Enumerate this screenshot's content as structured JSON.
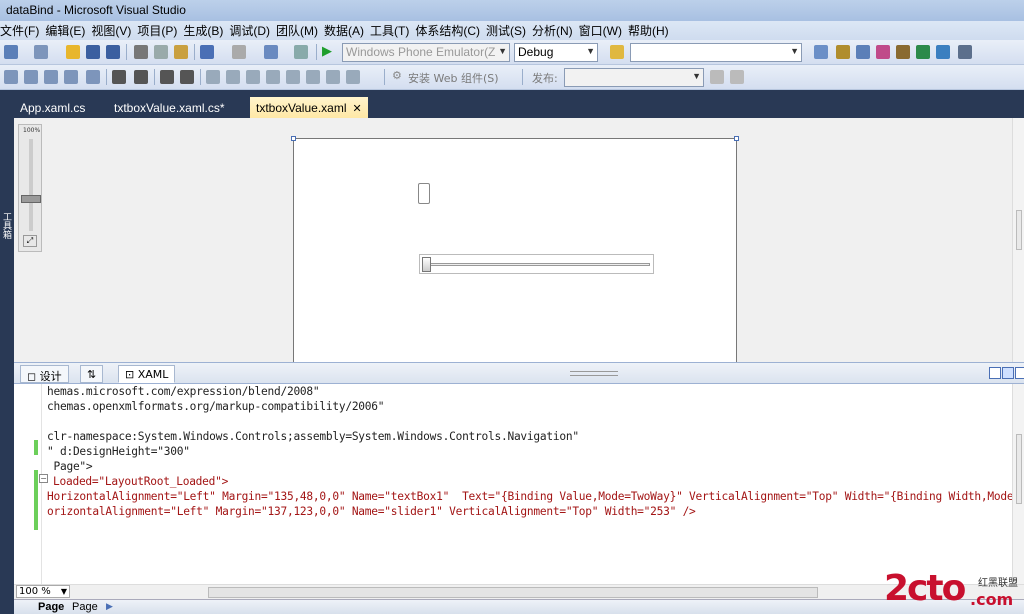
{
  "window": {
    "title": "dataBind - Microsoft Visual Studio"
  },
  "menu": [
    "文件(F)",
    "编辑(E)",
    "视图(V)",
    "项目(P)",
    "生成(B)",
    "调试(D)",
    "团队(M)",
    "数据(A)",
    "工具(T)",
    "体系结构(C)",
    "测试(S)",
    "分析(N)",
    "窗口(W)",
    "帮助(H)"
  ],
  "toolbar1": {
    "target": "Windows Phone Emulator(Z",
    "config": "Debug",
    "find": ""
  },
  "toolbar2": {
    "publish_web": "安装 Web 组件(S)",
    "publish_label": "发布:",
    "publish_value": ""
  },
  "tabs": [
    {
      "label": "App.xaml.cs"
    },
    {
      "label": "txtboxValue.xaml.cs*"
    },
    {
      "label": "txtboxValue.xaml",
      "close": "✕"
    }
  ],
  "side": {
    "toolbox_label": "工具箱"
  },
  "zoomrail": {
    "label": "100%"
  },
  "viewtabs": {
    "design": "设计",
    "swap": "⇅",
    "xaml": "XAML"
  },
  "code_lines": [
    {
      "text": "hemas.microsoft.com/expression/blend/2008\""
    },
    {
      "text": "chemas.openxmlformats.org/markup-compatibility/2006\""
    },
    {
      "text": ""
    },
    {
      "text": "clr-namespace:System.Windows.Controls;assembly=System.Windows.Controls.Navigation\""
    },
    {
      "text": "\" d:DesignHeight=\"300\""
    },
    {
      "text": " Page\">"
    },
    {
      "text": "Loaded=\"LayoutRoot_Loaded\">"
    },
    {
      "text": "HorizontalAlignment=\"Left\" Margin=\"135,48,0,0\" Name=\"textBox1\"  Text=\"{Binding Value,Mode=TwoWay}\" VerticalAlignment=\"Top\" Width=\"{Binding Width,Mode="
    },
    {
      "text": "orizontalAlignment=\"Left\" Margin=\"137,123,0,0\" Name=\"slider1\" VerticalAlignment=\"Top\" Width=\"253\" />"
    }
  ],
  "bottom": {
    "zoom": "100 %",
    "crumb1": "Page",
    "crumb2": "Page"
  },
  "watermark": {
    "big": "2cto",
    "small": "红黑联盟",
    "domain": ".com"
  }
}
